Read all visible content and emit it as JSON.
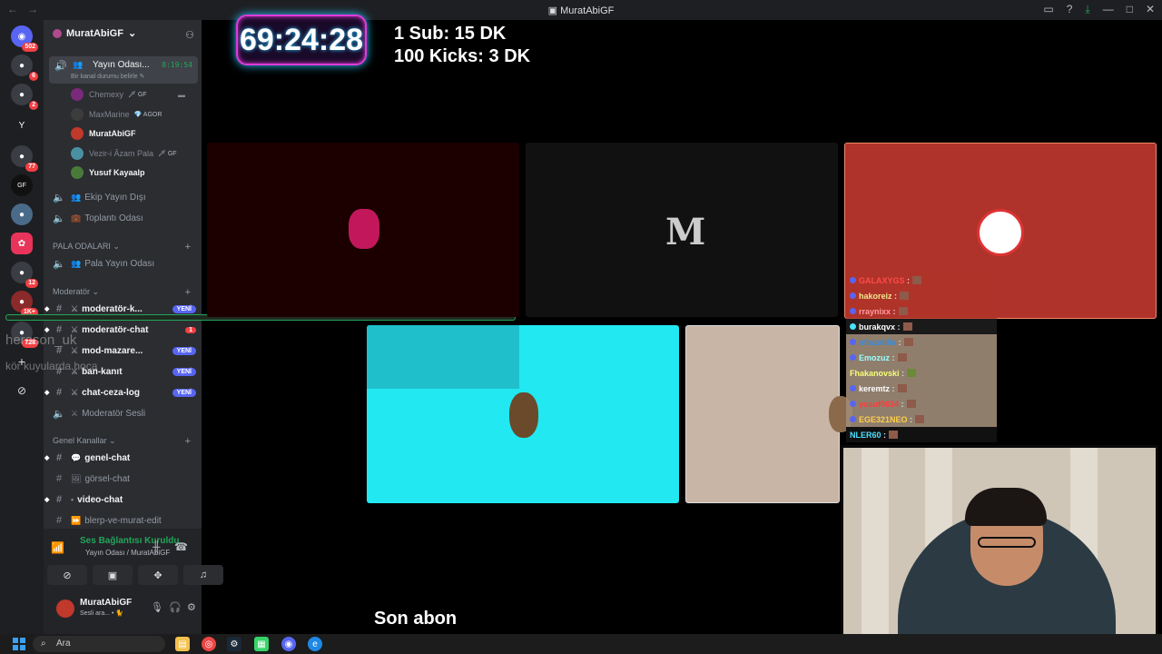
{
  "window": {
    "title": "MuratAbiGF",
    "nav_back": "←",
    "nav_forward": "→"
  },
  "rail": {
    "servers": [
      {
        "name": "discord-home",
        "badge": "502",
        "glyph": "◉"
      },
      {
        "name": "server-1",
        "badge": "6",
        "glyph": "●"
      },
      {
        "name": "server-2",
        "badge": "2",
        "glyph": "●"
      },
      {
        "name": "server-y",
        "badge": "",
        "glyph": "Y"
      },
      {
        "name": "server-3",
        "badge": "77",
        "glyph": "●"
      },
      {
        "name": "server-gf",
        "badge": "",
        "glyph": "GF"
      },
      {
        "name": "server-4",
        "badge": "",
        "glyph": "●"
      },
      {
        "name": "server-5",
        "badge": "",
        "glyph": "✿"
      },
      {
        "name": "server-6",
        "badge": "12",
        "glyph": "●"
      },
      {
        "name": "server-7",
        "badge": "1K+",
        "glyph": "●"
      },
      {
        "name": "server-8",
        "badge": "728",
        "glyph": "●"
      },
      {
        "name": "add-server",
        "badge": "",
        "glyph": "+"
      },
      {
        "name": "discover",
        "badge": "",
        "glyph": "⊘"
      }
    ]
  },
  "sidebar": {
    "server_name": "MuratAbiGF",
    "active_channel": {
      "name": "Yayın Odası...",
      "time": "8:19:54",
      "status": "Bir kanal durumu belirle ✎"
    },
    "members": [
      {
        "name": "Chemexy",
        "tag": "🗡 GF",
        "bold": false
      },
      {
        "name": "MaxMarine",
        "tag": "💎 AGOR",
        "bold": false
      },
      {
        "name": "MuratAbiGF",
        "tag": "",
        "bold": true
      },
      {
        "name": "Vezir-i Âzam Pala",
        "tag": "🗡 GF",
        "bold": false
      },
      {
        "name": "Yusuf Kayaalp",
        "tag": "",
        "bold": true
      }
    ],
    "voice_channels_top": [
      {
        "name": "Ekip Yayın Dışı",
        "emoji": "👥"
      },
      {
        "name": "Toplantı Odası",
        "emoji": "💼"
      }
    ],
    "cat_pala": "PALA ODALARI",
    "pala_channels": [
      {
        "name": "Pala Yayın Odası",
        "emoji": "👥"
      }
    ],
    "cat_mod": "Moderatör",
    "mod_channels": [
      {
        "name": "moderatör-k...",
        "emoji": "⚔",
        "badge": "YENİ",
        "type": "new"
      },
      {
        "name": "moderatör-chat",
        "emoji": "⚔",
        "badge": "1",
        "type": "red"
      },
      {
        "name": "mod-mazare...",
        "emoji": "⚔",
        "badge": "YENİ",
        "type": "new"
      },
      {
        "name": "ban-kanıt",
        "emoji": "⚔",
        "badge": "YENİ",
        "type": "new"
      },
      {
        "name": "chat-ceza-log",
        "emoji": "⚔",
        "badge": "YENİ",
        "type": "new"
      },
      {
        "name": "Moderatör Sesli",
        "emoji": "⚔",
        "badge": "",
        "type": "voice"
      }
    ],
    "cat_general": "Genel Kanallar",
    "general_channels": [
      {
        "name": "genel-chat",
        "emoji": "💬",
        "bold": true
      },
      {
        "name": "görsel-chat",
        "emoji": "🖼",
        "bold": false
      },
      {
        "name": "video-chat",
        "emoji": "•",
        "bold": true
      },
      {
        "name": "blerp-ve-murat-edit",
        "emoji": "⏩",
        "bold": false
      }
    ],
    "voice_status": {
      "title": "Ses Bağlantısı Kuruldu",
      "route": "Yayın Odası / MuratAbiGF"
    },
    "user": {
      "name": "MuratAbiGF",
      "status": "Sesli ara... • 🐈"
    }
  },
  "stage": {
    "timer": "69:24:28",
    "goal_line1": "1 Sub: 15 DK",
    "goal_line2": "100 Kicks: 3 DK",
    "tile2_logo": "M",
    "bottom_text": "Son abon",
    "watermark1": "heroson_uk",
    "watermark2": "kör kuyularda hoca"
  },
  "chat": [
    {
      "user": "GALAXYGS",
      "color": "#ff4a4a"
    },
    {
      "user": "hakoreiz",
      "color": "#f0e68c"
    },
    {
      "user": "rraynixx",
      "color": "#ff8a8a"
    },
    {
      "user": "burakqvx",
      "color": "#ffffff"
    },
    {
      "user": "oflazatilla",
      "color": "#5ab0ff"
    },
    {
      "user": "Emozuz",
      "color": "#9affff"
    },
    {
      "user": "Fhakanovski",
      "color": "#f6ff7a"
    },
    {
      "user": "keremtz",
      "color": "#ffffff"
    },
    {
      "user": "yusuf0634",
      "color": "#ff3b3b"
    },
    {
      "user": "EGE321NEO",
      "color": "#ffcf4a"
    },
    {
      "user": "NLER60",
      "color": "#4ae0ff"
    }
  ],
  "taskbar": {
    "search_placeholder": "Ara"
  },
  "colors": {
    "discord_bg": "#2b2d31",
    "rail_bg": "#1e1f22",
    "accent_green": "#23a55a",
    "new_badge": "#5865f2",
    "tile_cyan": "#22e8f2",
    "tile_red": "#b0332b"
  }
}
